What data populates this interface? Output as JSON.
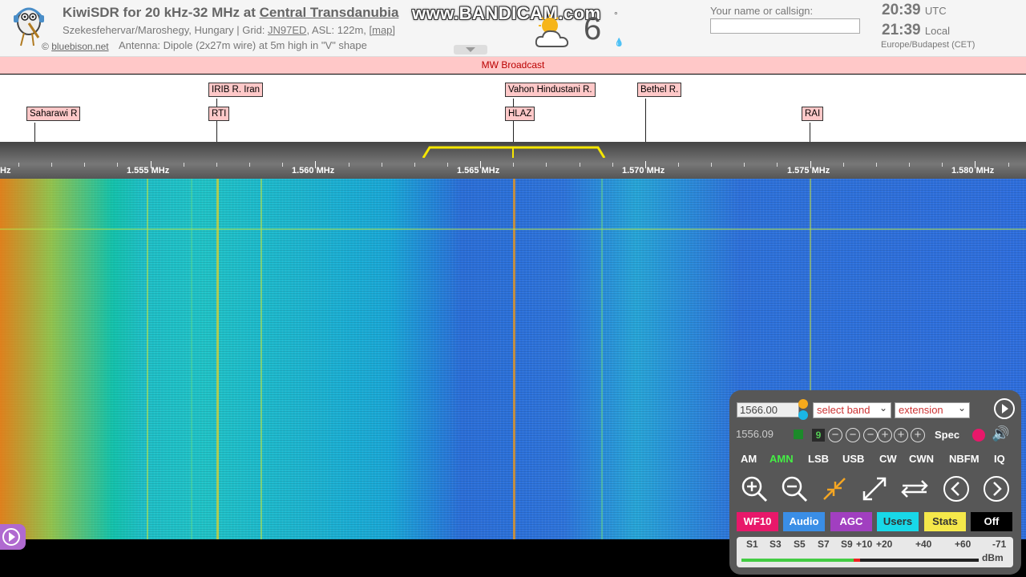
{
  "header": {
    "title_prefix": "KiwiSDR for 20 kHz-32 MHz at ",
    "title_location": "Central Transdanubia",
    "subtitle_prefix": "Szekesfehervar/Maroshegy, Hungary | Grid: ",
    "grid": "JN97ED",
    "subtitle_mid": ", ASL: 122m, ",
    "map_link": "[map]",
    "logo_credit": "bluebison.net",
    "copyright_symbol": "©",
    "antenna": "Antenna: Dipole (2x27m wire) at 5m high in \"V\" shape",
    "watermark": "www.BANDICAM.com",
    "temperature": "6",
    "temp_unit": "°",
    "name_label": "Your name or callsign:",
    "name_value": "",
    "utc_time": "20:39",
    "utc_label": "UTC",
    "local_time": "21:39",
    "local_label": "Local",
    "timezone": "Europe/Budapest (CET)"
  },
  "band": {
    "name": "MW Broadcast"
  },
  "dx_labels": [
    {
      "text": "Saharawi R"
    },
    {
      "text": "IRIB R. Iran"
    },
    {
      "text": "RTI"
    },
    {
      "text": "Vahon Hindustani R."
    },
    {
      "text": "HLAZ"
    },
    {
      "text": "Bethel R."
    },
    {
      "text": "RAI"
    }
  ],
  "scale": {
    "left_partial": "Hz",
    "labels": [
      "1.555 MHz",
      "1.560 MHz",
      "1.565 MHz",
      "1.570 MHz",
      "1.575 MHz",
      "1.580 MHz"
    ]
  },
  "controls": {
    "frequency": "1566.00",
    "band_select": "select band",
    "extension_select": "extension",
    "freq_secondary": "1556.09",
    "zoom_level": "9",
    "spec_label": "Spec",
    "modes": [
      "AM",
      "AMN",
      "LSB",
      "USB",
      "CW",
      "CWN",
      "NBFM",
      "IQ"
    ],
    "active_mode": "AMN",
    "tabs": [
      {
        "label": "WF10",
        "bg": "#e8186a",
        "fg": "#ffffff"
      },
      {
        "label": "Audio",
        "bg": "#3a8ee6",
        "fg": "#ffffff"
      },
      {
        "label": "AGC",
        "bg": "#a13fc0",
        "fg": "#ffffff"
      },
      {
        "label": "Users",
        "bg": "#18d8e8",
        "fg": "#333333"
      },
      {
        "label": "Stats",
        "bg": "#f5e84a",
        "fg": "#333333"
      },
      {
        "label": "Off",
        "bg": "#000000",
        "fg": "#ffffff"
      }
    ],
    "smeter": {
      "scale": [
        "S1",
        "S3",
        "S5",
        "S7",
        "S9",
        "+10",
        "+20",
        "+40",
        "+60"
      ],
      "value": "-71",
      "unit": "dBm"
    }
  },
  "colors": {
    "band_bar": "#ffc8c8",
    "passband": "#f5e600",
    "panel_bg": "#575757"
  }
}
